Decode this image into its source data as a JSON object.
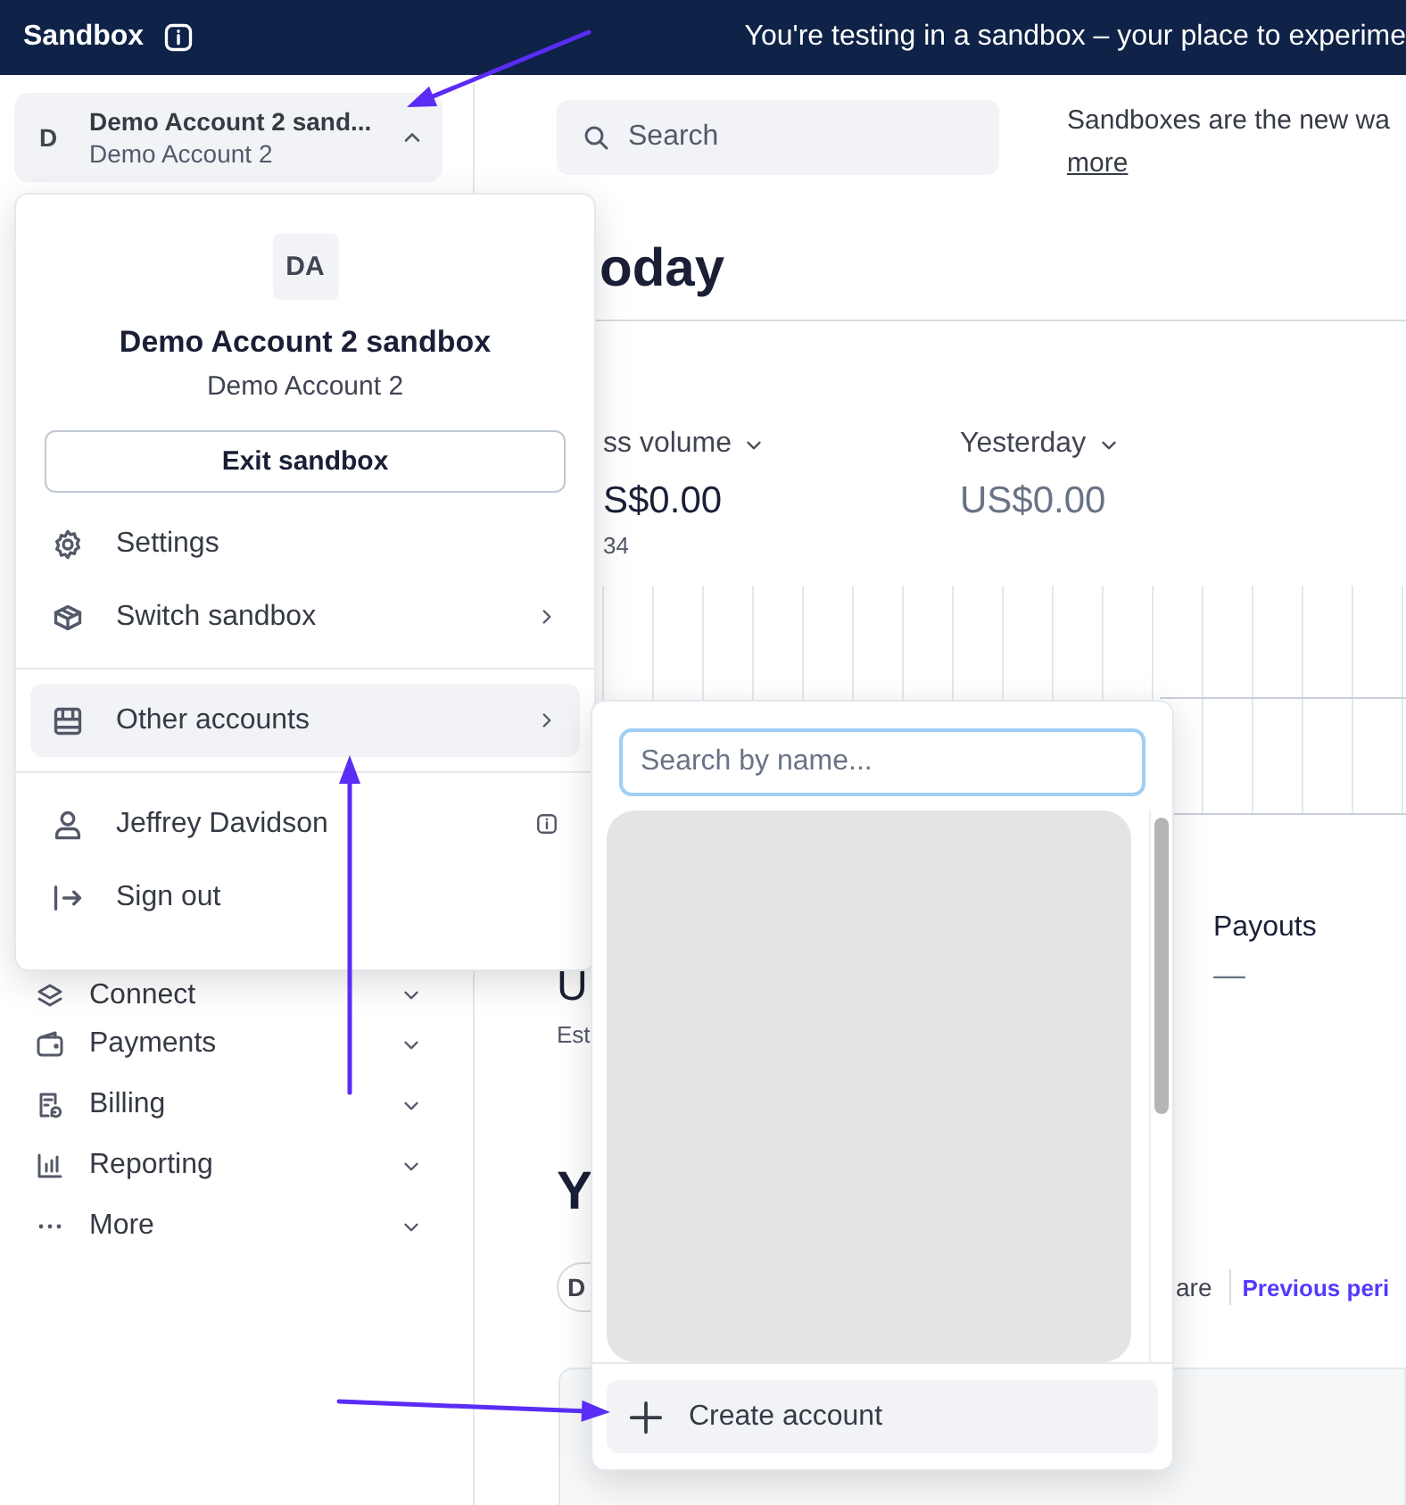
{
  "top_bar": {
    "title": "Sandbox",
    "message": "You're testing in a sandbox – your place to experime"
  },
  "account_switcher": {
    "initial": "D",
    "name": "Demo Account 2 sand...",
    "account": "Demo Account 2",
    "expanded": true
  },
  "sidebar": {
    "items": [
      {
        "label": "Connect"
      },
      {
        "label": "Payments"
      },
      {
        "label": "Billing"
      },
      {
        "label": "Reporting"
      },
      {
        "label": "More"
      }
    ]
  },
  "search": {
    "placeholder": "Search"
  },
  "notice": {
    "text": "Sandboxes are the new wa",
    "link": "more"
  },
  "main": {
    "heading": "oday",
    "metrics": [
      {
        "label": "ss volume",
        "value": "S$0.00",
        "note": "34"
      },
      {
        "label": "Yesterday",
        "value": "US$0.00"
      }
    ],
    "balance": {
      "value": "U",
      "note": "Est"
    },
    "payouts": {
      "label": "Payouts",
      "value": "—"
    },
    "section_heading": "Y",
    "filter_chip": "D",
    "compare_label": "are",
    "compare_link": "Previous peri"
  },
  "account_menu": {
    "avatar": "DA",
    "title": "Demo Account 2 sandbox",
    "subtitle": "Demo Account 2",
    "exit_button": "Exit sandbox",
    "groups": [
      [
        {
          "label": "Settings",
          "selected": false,
          "submenu": false,
          "info": false
        },
        {
          "label": "Switch sandbox",
          "selected": false,
          "submenu": true,
          "info": false
        }
      ],
      [
        {
          "label": "Other accounts",
          "selected": true,
          "submenu": true,
          "info": false
        }
      ],
      [
        {
          "label": "Jeffrey Davidson",
          "selected": false,
          "submenu": false,
          "info": true
        },
        {
          "label": "Sign out",
          "selected": false,
          "submenu": false,
          "info": false
        }
      ]
    ]
  },
  "accounts_submenu": {
    "placeholder": "Search by name...",
    "create_button": "Create account"
  }
}
